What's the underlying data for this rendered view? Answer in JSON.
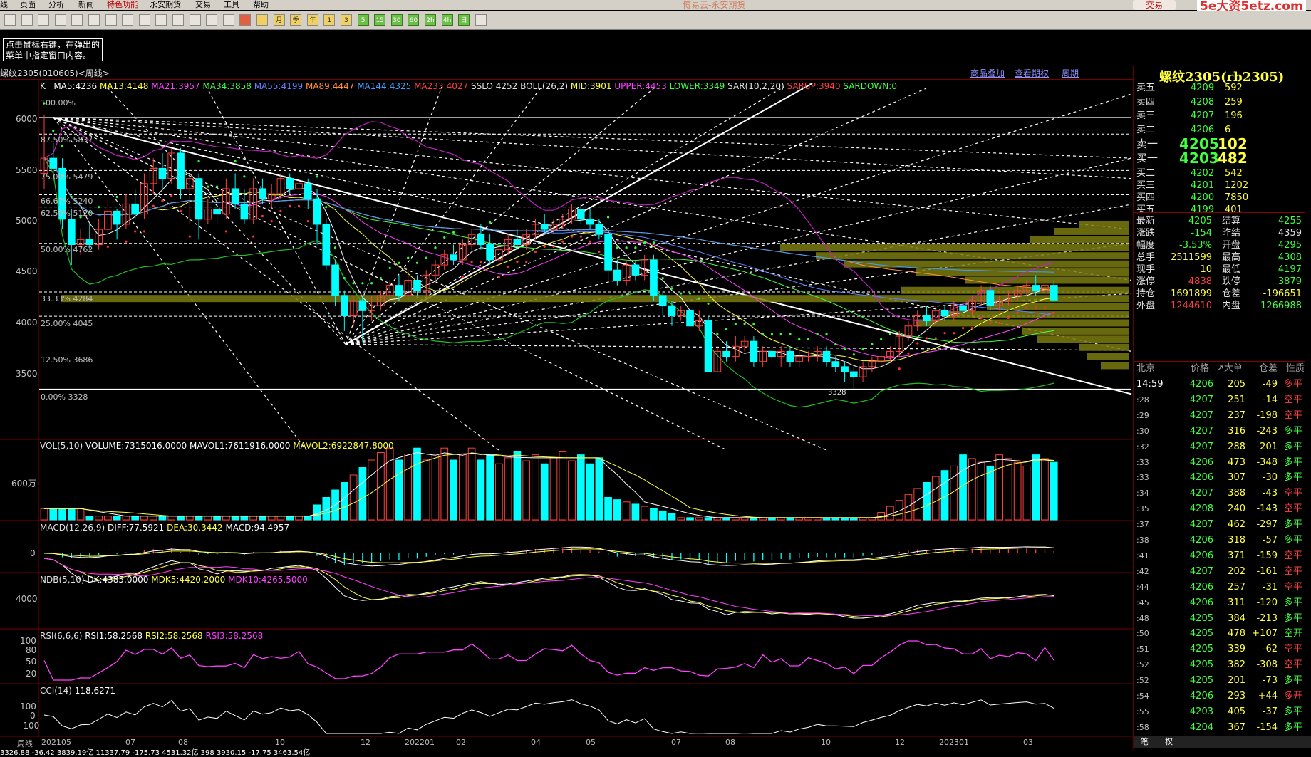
{
  "menu": [
    "线",
    "页面",
    "分析",
    "新闻",
    "特色功能",
    "永安期货",
    "交易",
    "工具",
    "帮助"
  ],
  "app_title": "博易云-永安期货",
  "trade_button": "交易",
  "watermark": "5e大资5etz.com",
  "toolbar_icons": [
    "home-icon",
    "back-icon",
    "forward-icon",
    "refresh-icon",
    "search-icon",
    "zoom-in-icon",
    "zoom-out-icon",
    "pen-icon",
    "eraser-icon",
    "paint-icon",
    "funnel-icon",
    "pin-icon",
    "table-icon",
    "chart-icon",
    "tick-icon",
    "kline-icon",
    "月",
    "季",
    "年",
    "1",
    "3",
    "5",
    "15",
    "30",
    "60",
    "2h",
    "4h",
    "日",
    "calendar-icon"
  ],
  "note": "点击鼠标右键，在弹出的菜单中指定窗口内容。",
  "chart_header": {
    "symbol": "螺纹2305(010605)<周线>",
    "links": [
      "商品叠加",
      "查看期权",
      "周期"
    ]
  },
  "main_indicators": {
    "k": "K",
    "ma5": "MA5:4236",
    "ma13": "MA13:4148",
    "ma21": "MA21:3957",
    "ma34": "MA34:3858",
    "ma55": "MA55:4199",
    "ma89": "MA89:4447",
    "ma144": "MA144:4325",
    "ma233": "MA233:4027",
    "sslo": "SSLO 4252",
    "boll": "BOLL(26,2)",
    "mid": "MID:3901",
    "upper": "UPPER:4453",
    "lower": "LOWER:3349",
    "sar": "SAR(10,2,20)",
    "sarup": "SARUP:3940",
    "sardown": "SARDOWN:0"
  },
  "price_axis": [
    "6000",
    "5500",
    "5000",
    "4500",
    "4000",
    "3500"
  ],
  "fib_levels": [
    "100.00%",
    "87.50%  5837",
    "75.00%  5479",
    "66.67%  5240",
    "62.50%  5120",
    "50.00%  4762",
    "33.33%  4284",
    "25.00%  4045",
    "12.50%  3686",
    "0.00%  3328"
  ],
  "low_marker": "3328",
  "vol": {
    "label": "VOL(5,10)",
    "volume": "VOLUME:7315016.0000",
    "mavol1": "MAVOL1:7611916.0000",
    "mavol2": "MAVOL2:6922847.8000",
    "axis": "600万"
  },
  "macd": {
    "label": "MACD(12,26,9)",
    "diff": "DIFF:77.5921",
    "dea": "DEA:30.3442",
    "macd": "MACD:94.4957",
    "axis": "0"
  },
  "ndb": {
    "label": "NDB(5,10)",
    "dk": "DK:4385.0000",
    "mdk5": "MDK5:4420.2000",
    "mdk10": "MDK10:4265.5000",
    "axis": "4000"
  },
  "rsi": {
    "label": "RSI(6,6,6)",
    "rsi1": "RSI1:58.2568",
    "rsi2": "RSI2:58.2568",
    "rsi3": "RSI3:58.2568",
    "axis": [
      "100",
      "80",
      "50",
      "20"
    ]
  },
  "cci": {
    "label": "CCI(14)",
    "value": "118.6271",
    "axis": [
      "100",
      "0",
      "-100"
    ]
  },
  "x_axis": [
    "周线",
    "202105",
    "07",
    "08",
    "10",
    "12",
    "202201",
    "02",
    "04",
    "05",
    "07",
    "08",
    "10",
    "12",
    "202301",
    "03"
  ],
  "quote": {
    "title": "螺纹2305(rb2305)",
    "asks": [
      {
        "label": "卖五",
        "price": "4209",
        "vol": "592"
      },
      {
        "label": "卖四",
        "price": "4208",
        "vol": "259"
      },
      {
        "label": "卖三",
        "price": "4207",
        "vol": "196"
      },
      {
        "label": "卖二",
        "price": "4206",
        "vol": "6"
      },
      {
        "label": "卖一",
        "price": "4205",
        "vol": "102"
      }
    ],
    "bids": [
      {
        "label": "买一",
        "price": "4203",
        "vol": "482"
      },
      {
        "label": "买二",
        "price": "4202",
        "vol": "542"
      },
      {
        "label": "买三",
        "price": "4201",
        "vol": "1202"
      },
      {
        "label": "买四",
        "price": "4200",
        "vol": "7850"
      },
      {
        "label": "买五",
        "price": "4199",
        "vol": "401"
      }
    ],
    "stats": [
      {
        "l1": "最新",
        "v1": "4205",
        "c1": "#40ff40",
        "l2": "结算",
        "v2": "4255",
        "c2": "#40ff40"
      },
      {
        "l1": "涨跌",
        "v1": "-154",
        "c1": "#40ff40",
        "l2": "昨结",
        "v2": "4359",
        "c2": "#e0e0e0"
      },
      {
        "l1": "幅度",
        "v1": "-3.53%",
        "c1": "#40ff40",
        "l2": "开盘",
        "v2": "4295",
        "c2": "#40ff40"
      },
      {
        "l1": "总手",
        "v1": "2511599",
        "c1": "#ffff40",
        "l2": "最高",
        "v2": "4308",
        "c2": "#40ff40"
      },
      {
        "l1": "现手",
        "v1": "10",
        "c1": "#ffff40",
        "l2": "最低",
        "v2": "4197",
        "c2": "#40ff40"
      },
      {
        "l1": "涨停",
        "v1": "4838",
        "c1": "#ff4040",
        "l2": "跌停",
        "v2": "3879",
        "c2": "#40ff40"
      },
      {
        "l1": "持仓",
        "v1": "1691899",
        "c1": "#ffff40",
        "l2": "仓差",
        "v2": "-196651",
        "c2": "#ffff40"
      },
      {
        "l1": "外盘",
        "v1": "1244610",
        "c1": "#ff4040",
        "l2": "内盘",
        "v2": "1266988",
        "c2": "#40ff40"
      }
    ],
    "tick_header": {
      "city": "北京",
      "price": "价格",
      "vol": "↗大单",
      "oi": "仓差",
      "nature": "性质"
    },
    "ticks": [
      {
        "t": "14:59",
        "p": "4206",
        "v": "205",
        "d": "-49",
        "n": "多平",
        "nc": "#ff4040"
      },
      {
        "t": ":28",
        "p": "4207",
        "v": "251",
        "d": "-14",
        "n": "空平",
        "nc": "#ff4040"
      },
      {
        "t": ":29",
        "p": "4207",
        "v": "237",
        "d": "-198",
        "n": "空平",
        "nc": "#ff4040"
      },
      {
        "t": ":30",
        "p": "4207",
        "v": "316",
        "d": "-243",
        "n": "多平",
        "nc": "#40ff40"
      },
      {
        "t": ":32",
        "p": "4207",
        "v": "288",
        "d": "-201",
        "n": "多平",
        "nc": "#40ff40"
      },
      {
        "t": ":33",
        "p": "4206",
        "v": "473",
        "d": "-348",
        "n": "多平",
        "nc": "#40ff40"
      },
      {
        "t": ":33",
        "p": "4206",
        "v": "307",
        "d": "-30",
        "n": "多平",
        "nc": "#40ff40"
      },
      {
        "t": ":34",
        "p": "4207",
        "v": "388",
        "d": "-43",
        "n": "空平",
        "nc": "#ff4040"
      },
      {
        "t": ":35",
        "p": "4208",
        "v": "240",
        "d": "-143",
        "n": "空平",
        "nc": "#ff4040"
      },
      {
        "t": ":37",
        "p": "4207",
        "v": "462",
        "d": "-297",
        "n": "多平",
        "nc": "#40ff40"
      },
      {
        "t": ":38",
        "p": "4206",
        "v": "318",
        "d": "-57",
        "n": "多平",
        "nc": "#40ff40"
      },
      {
        "t": ":41",
        "p": "4206",
        "v": "371",
        "d": "-159",
        "n": "空平",
        "nc": "#ff4040"
      },
      {
        "t": ":42",
        "p": "4207",
        "v": "202",
        "d": "-161",
        "n": "空平",
        "nc": "#ff4040"
      },
      {
        "t": ":44",
        "p": "4206",
        "v": "257",
        "d": "-31",
        "n": "空平",
        "nc": "#ff4040"
      },
      {
        "t": ":45",
        "p": "4206",
        "v": "311",
        "d": "-120",
        "n": "多平",
        "nc": "#40ff40"
      },
      {
        "t": ":48",
        "p": "4205",
        "v": "384",
        "d": "-213",
        "n": "多平",
        "nc": "#40ff40"
      },
      {
        "t": ":50",
        "p": "4205",
        "v": "478",
        "d": "+107",
        "n": "空开",
        "nc": "#40ff40"
      },
      {
        "t": ":51",
        "p": "4205",
        "v": "339",
        "d": "-62",
        "n": "空平",
        "nc": "#ff4040"
      },
      {
        "t": ":52",
        "p": "4205",
        "v": "382",
        "d": "-308",
        "n": "空平",
        "nc": "#ff4040"
      },
      {
        "t": ":52",
        "p": "4205",
        "v": "201",
        "d": "-73",
        "n": "多平",
        "nc": "#40ff40"
      },
      {
        "t": ":54",
        "p": "4206",
        "v": "293",
        "d": "+44",
        "n": "多开",
        "nc": "#ff4040"
      },
      {
        "t": ":55",
        "p": "4203",
        "v": "405",
        "d": "-37",
        "n": "多平",
        "nc": "#40ff40"
      },
      {
        "t": ":58",
        "p": "4204",
        "v": "367",
        "d": "-154",
        "n": "多平",
        "nc": "#40ff40"
      }
    ],
    "bottom_tabs": [
      "笔",
      "权"
    ]
  },
  "statusbar": "3326.88   -36.42  3839.19亿   11337.79   -175.73  4531.32亿   398  3930.15   -17.75  3463.54亿",
  "colors": {
    "up": "#ff4040",
    "down": "#00ffff",
    "ma5": "#ffffff",
    "ma13": "#ffff40",
    "ma21": "#ff40ff",
    "ma34": "#40ff40"
  }
}
